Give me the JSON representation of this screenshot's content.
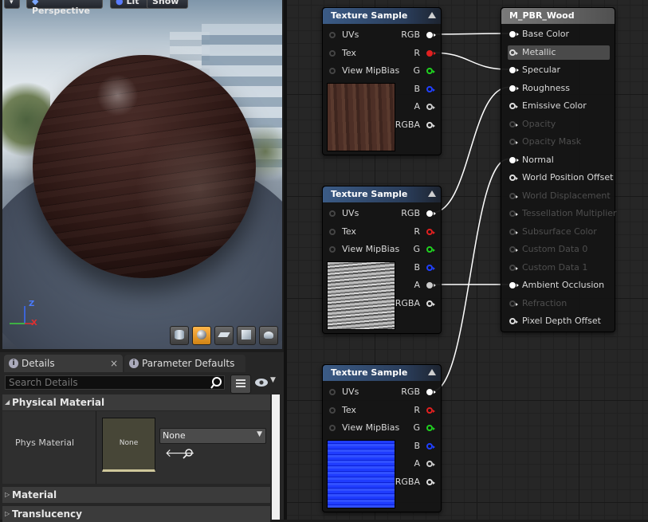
{
  "viewport": {
    "mode_label": "Perspective",
    "lit_label": "Lit",
    "show_label": "Show",
    "axis_z": "Z",
    "axis_x": "X",
    "axis_y": "Y",
    "preview_shapes": [
      "cylinder-icon",
      "sphere-icon",
      "plane-icon",
      "cube-icon",
      "teapot-icon"
    ],
    "active_shape": 1
  },
  "details": {
    "tabs": [
      {
        "label": "Details",
        "close": "×"
      },
      {
        "label": "Parameter Defaults",
        "close": ""
      }
    ],
    "search_placeholder": "Search Details",
    "section_physical": "Physical Material",
    "phys_label": "Phys Material",
    "thumb_label": "None",
    "dropdown_value": "None",
    "section_material": "Material",
    "section_translucency": "Translucency"
  },
  "texture_nodes": [
    {
      "title": "Texture Sample",
      "inputs": [
        "UVs",
        "Tex",
        "View MipBias"
      ],
      "outputs": [
        {
          "label": "RGB",
          "color": "#ffffff",
          "connected": true
        },
        {
          "label": "R",
          "color": "#e02020",
          "connected": true
        },
        {
          "label": "G",
          "color": "#20d020",
          "connected": false
        },
        {
          "label": "B",
          "color": "#2040ff",
          "connected": false
        },
        {
          "label": "A",
          "color": "#cccccc",
          "connected": false
        },
        {
          "label": "RGBA",
          "color": "#dddddd",
          "connected": false
        }
      ],
      "preview": "wood"
    },
    {
      "title": "Texture Sample",
      "inputs": [
        "UVs",
        "Tex",
        "View MipBias"
      ],
      "outputs": [
        {
          "label": "RGB",
          "color": "#ffffff",
          "connected": true
        },
        {
          "label": "R",
          "color": "#e02020",
          "connected": false
        },
        {
          "label": "G",
          "color": "#20d020",
          "connected": false
        },
        {
          "label": "B",
          "color": "#2040ff",
          "connected": false
        },
        {
          "label": "A",
          "color": "#cccccc",
          "connected": true
        },
        {
          "label": "RGBA",
          "color": "#dddddd",
          "connected": false
        }
      ],
      "preview": "gray"
    },
    {
      "title": "Texture Sample",
      "inputs": [
        "UVs",
        "Tex",
        "View MipBias"
      ],
      "outputs": [
        {
          "label": "RGB",
          "color": "#ffffff",
          "connected": true
        },
        {
          "label": "R",
          "color": "#e02020",
          "connected": false
        },
        {
          "label": "G",
          "color": "#20d020",
          "connected": false
        },
        {
          "label": "B",
          "color": "#2040ff",
          "connected": false
        },
        {
          "label": "A",
          "color": "#cccccc",
          "connected": false
        },
        {
          "label": "RGBA",
          "color": "#dddddd",
          "connected": false
        }
      ],
      "preview": "normal"
    }
  ],
  "main_node": {
    "title": "M_PBR_Wood",
    "inputs": [
      {
        "label": "Base Color",
        "enabled": true,
        "connected": true
      },
      {
        "label": "Metallic",
        "enabled": true,
        "connected": false,
        "highlighted": true
      },
      {
        "label": "Specular",
        "enabled": true,
        "connected": true
      },
      {
        "label": "Roughness",
        "enabled": true,
        "connected": true
      },
      {
        "label": "Emissive Color",
        "enabled": true,
        "connected": false
      },
      {
        "label": "Opacity",
        "enabled": false,
        "connected": false
      },
      {
        "label": "Opacity Mask",
        "enabled": false,
        "connected": false
      },
      {
        "label": "Normal",
        "enabled": true,
        "connected": true
      },
      {
        "label": "World Position Offset",
        "enabled": true,
        "connected": false
      },
      {
        "label": "World Displacement",
        "enabled": false,
        "connected": false
      },
      {
        "label": "Tessellation Multiplier",
        "enabled": false,
        "connected": false
      },
      {
        "label": "Subsurface Color",
        "enabled": false,
        "connected": false
      },
      {
        "label": "Custom Data 0",
        "enabled": false,
        "connected": false
      },
      {
        "label": "Custom Data 1",
        "enabled": false,
        "connected": false
      },
      {
        "label": "Ambient Occlusion",
        "enabled": true,
        "connected": true
      },
      {
        "label": "Refraction",
        "enabled": false,
        "connected": false
      },
      {
        "label": "Pixel Depth Offset",
        "enabled": true,
        "connected": false
      }
    ]
  },
  "colors": {
    "node_header_texture": "#3b5b86",
    "node_header_main": "#6b6b6b",
    "wire": "#ffffff",
    "active_shape": "#f0a030"
  }
}
